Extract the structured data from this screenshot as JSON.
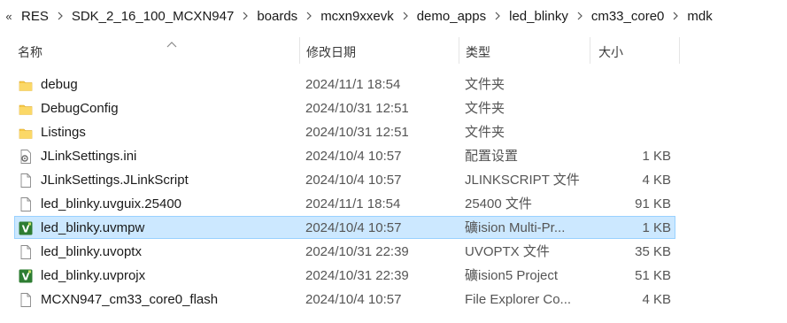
{
  "breadcrumb": {
    "overflow": "«",
    "items": [
      "RES",
      "SDK_2_16_100_MCXN947",
      "boards",
      "mcxn9xxevk",
      "demo_apps",
      "led_blinky",
      "cm33_core0",
      "mdk"
    ]
  },
  "columns": {
    "name": "名称",
    "date": "修改日期",
    "type": "类型",
    "size": "大小"
  },
  "files": [
    {
      "name": "debug",
      "date": "2024/11/1 18:54",
      "type": "文件夹",
      "size": "",
      "icon": "folder-icon"
    },
    {
      "name": "DebugConfig",
      "date": "2024/10/31 12:51",
      "type": "文件夹",
      "size": "",
      "icon": "folder-icon"
    },
    {
      "name": "Listings",
      "date": "2024/10/31 12:51",
      "type": "文件夹",
      "size": "",
      "icon": "folder-icon"
    },
    {
      "name": "JLinkSettings.ini",
      "date": "2024/10/4 10:57",
      "type": "配置设置",
      "size": "1 KB",
      "icon": "settings-file-icon"
    },
    {
      "name": "JLinkSettings.JLinkScript",
      "date": "2024/10/4 10:57",
      "type": "JLINKSCRIPT 文件",
      "size": "4 KB",
      "icon": "file-icon"
    },
    {
      "name": "led_blinky.uvguix.25400",
      "date": "2024/11/1 18:54",
      "type": "25400 文件",
      "size": "91 KB",
      "icon": "file-icon"
    },
    {
      "name": "led_blinky.uvmpw",
      "date": "2024/10/4 10:57",
      "type": "礦ision Multi-Pr...",
      "size": "1 KB",
      "icon": "keil-project-icon",
      "selected": true
    },
    {
      "name": "led_blinky.uvoptx",
      "date": "2024/10/31 22:39",
      "type": "UVOPTX 文件",
      "size": "35 KB",
      "icon": "file-icon"
    },
    {
      "name": "led_blinky.uvprojx",
      "date": "2024/10/31 22:39",
      "type": "礦ision5 Project",
      "size": "51 KB",
      "icon": "keil-project-icon"
    },
    {
      "name": "MCXN947_cm33_core0_flash",
      "date": "2024/10/4 10:57",
      "type": "File Explorer Co...",
      "size": "4 KB",
      "icon": "file-icon"
    }
  ],
  "colors": {
    "selection_bg": "#cce8ff",
    "selection_border": "#99d1ff",
    "folder": "#f7c948",
    "keil_green": "#2e7d32"
  }
}
